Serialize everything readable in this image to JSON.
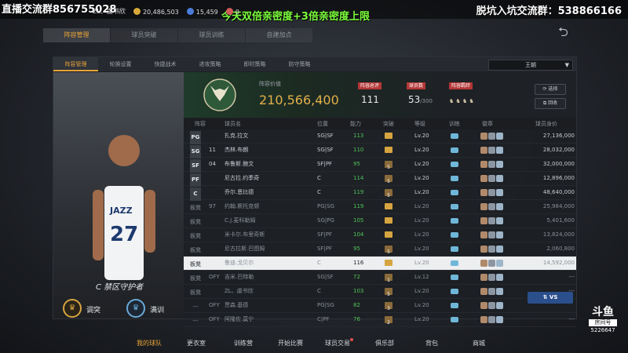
{
  "overlay": {
    "left_text": "直播交流群856755028",
    "right_text": "脱坑入坑交流群：538866166",
    "green_text": "今天双倍亲密度+3倍亲密度上限"
  },
  "top_stats": {
    "user": "ZL、虞书欣",
    "coins": "20,486,503",
    "vc": "15,459",
    "other": "0"
  },
  "main_tabs": [
    "阵容管理",
    "球员突破",
    "球员训练",
    "自建加点"
  ],
  "sub_tabs": [
    "阵容管理",
    "轮换设置",
    "快捷战术",
    "进攻策略",
    "即时策略",
    "防守策略"
  ],
  "team_dropdown": "王朝",
  "player": {
    "number": "27",
    "team_text": "JAZZ",
    "role": "C 禁区守护者",
    "adjust_label": "调突",
    "max_label": "满训"
  },
  "team_header": {
    "value_label": "阵容价值",
    "value": "210,566,400",
    "total_label": "阵容总评",
    "total": "111",
    "count_label": "球员数",
    "count": "53",
    "count_max": "/300",
    "chem_label": "阵容羁绊",
    "btn_select": "选择",
    "btn_rollback": "回收"
  },
  "table": {
    "headers": [
      "阵容",
      "球员名",
      "位置",
      "能力",
      "突破",
      "等级",
      "训练",
      "徽章",
      "球员身价"
    ],
    "rows": [
      {
        "slot": "PG",
        "num": "",
        "name": "扎克.拉文",
        "pos": "SG|SF",
        "ovr": "113",
        "brk": "",
        "lvl": "Lv.20",
        "price": "27,136,000"
      },
      {
        "slot": "SG",
        "num": "11",
        "name": "杰林.布朗",
        "pos": "SG|SF",
        "ovr": "110",
        "brk": "",
        "lvl": "Lv.20",
        "price": "28,032,000"
      },
      {
        "slot": "SF",
        "num": "04",
        "name": "布鲁斯.鲍文",
        "pos": "SF|PF",
        "ovr": "95",
        "brk": "5",
        "lvl": "Lv.20",
        "price": "32,000,000"
      },
      {
        "slot": "PF",
        "num": "",
        "name": "尼古拉.约季奇",
        "pos": "C",
        "ovr": "114",
        "brk": "5",
        "lvl": "Lv.20",
        "price": "12,896,000"
      },
      {
        "slot": "C",
        "num": "",
        "name": "乔尔.恩比德",
        "pos": "C",
        "ovr": "119",
        "brk": "5",
        "lvl": "Lv.20",
        "price": "48,640,000"
      },
      {
        "slot": "板凳",
        "num": "97",
        "name": "约翰.斯托克顿",
        "pos": "PG|SG",
        "ovr": "119",
        "brk": "",
        "lvl": "Lv.20",
        "price": "25,984,000"
      },
      {
        "slot": "板凳",
        "num": "",
        "name": "C.J.麦科勒姆",
        "pos": "SG|PG",
        "ovr": "105",
        "brk": "",
        "lvl": "Lv.20",
        "price": "5,401,600"
      },
      {
        "slot": "板凳",
        "num": "",
        "name": "米卡尔.布里奇斯",
        "pos": "SF|PF",
        "ovr": "104",
        "brk": "",
        "lvl": "Lv.20",
        "price": "13,824,000"
      },
      {
        "slot": "板凳",
        "num": "",
        "name": "尼古拉斯.巴图姆",
        "pos": "SF|PF",
        "ovr": "95",
        "brk": "5",
        "lvl": "Lv.20",
        "price": "2,060,800"
      },
      {
        "slot": "板凳",
        "num": "",
        "name": "鲁迪.戈贝尔",
        "pos": "C",
        "ovr": "116",
        "brk": "",
        "lvl": "Lv.20",
        "price": "14,592,000"
      },
      {
        "slot": "板凳",
        "num": "OFY",
        "name": "吉米.巴特勒",
        "pos": "SG|SF",
        "ovr": "72",
        "brk": "1",
        "lvl": "Lv.12",
        "price": "---"
      },
      {
        "slot": "板凳",
        "num": "",
        "name": "ZL、虞书欣",
        "pos": "C",
        "ovr": "103",
        "brk": "5",
        "lvl": "Lv.20",
        "price": "---"
      },
      {
        "slot": "---",
        "num": "OFY",
        "name": "贾森.基德",
        "pos": "PG|SG",
        "ovr": "82",
        "brk": "3",
        "lvl": "Lv.20",
        "price": ""
      },
      {
        "slot": "---",
        "num": "OFY",
        "name": "阿隆佐.莫宁",
        "pos": "C|PF",
        "ovr": "76",
        "brk": "2",
        "lvl": "Lv.20",
        "price": "---"
      }
    ]
  },
  "vs_label": "VS",
  "bottom_nav": [
    "我的球队",
    "更衣室",
    "训练营",
    "开始比赛",
    "球员交易",
    "俱乐部",
    "背包",
    "商城"
  ],
  "douyu": {
    "brand": "斗鱼",
    "room_label": "房间号",
    "room": "5226647"
  }
}
